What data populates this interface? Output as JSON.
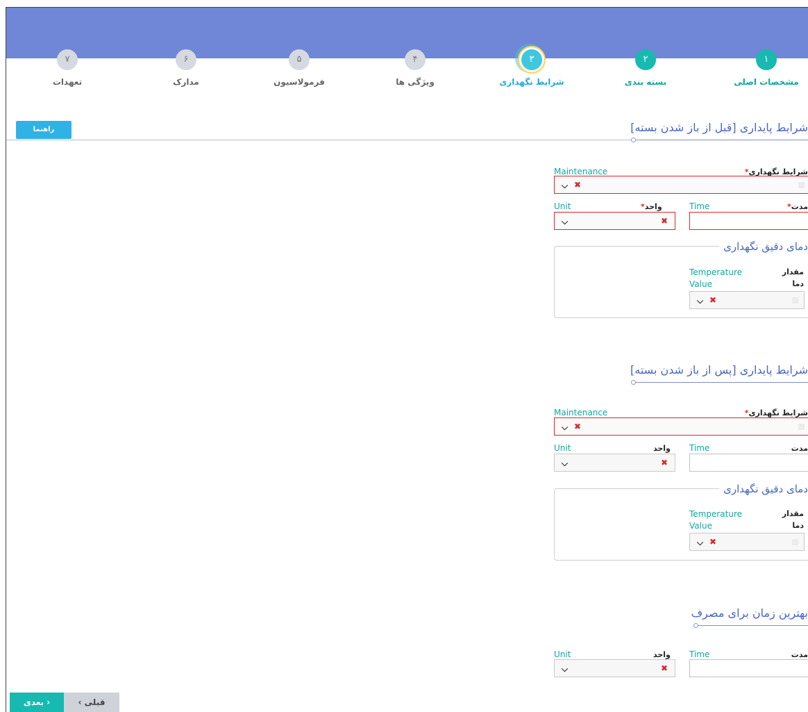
{
  "steps": [
    {
      "num": "۱",
      "label": "مشخصات اصلی",
      "state": "done"
    },
    {
      "num": "۲",
      "label": "بسته بندی",
      "state": "done"
    },
    {
      "num": "۳",
      "label": "شرایط نگهداری",
      "state": "active"
    },
    {
      "num": "۴",
      "label": "ویژگی ها",
      "state": "todo"
    },
    {
      "num": "۵",
      "label": "فرمولاسیون",
      "state": "todo"
    },
    {
      "num": "۶",
      "label": "مدارک",
      "state": "todo"
    },
    {
      "num": "۷",
      "label": "تعهدات",
      "state": "todo"
    }
  ],
  "help_button": "راهنما",
  "before_open": {
    "title": "شرایط پایداری [قبل از باز شدن بسته]",
    "maintenance_fa": "شرایط نگهداری",
    "maintenance_en": "Maintenance",
    "duration_fa": "مدت",
    "time_en": "Time",
    "unit_fa": "واحد",
    "unit_en": "Unit",
    "temp_panel_title": "دمای دقیق نگهداری",
    "temp_fa_1": "مقدار",
    "temp_fa_2": "دما",
    "temp_en_1": "Temperature",
    "temp_en_2": "Value"
  },
  "after_open": {
    "title": "شرایط پایداری [پس از باز شدن بسته]",
    "maintenance_fa": "شرایط نگهداری",
    "maintenance_en": "Maintenance",
    "duration_fa": "مدت",
    "time_en": "Time",
    "unit_fa": "واحد",
    "unit_en": "Unit",
    "temp_panel_title": "دمای دقیق نگهداری",
    "temp_fa_1": "مقدار",
    "temp_fa_2": "دما",
    "temp_en_1": "Temperature",
    "temp_en_2": "Value"
  },
  "best_time": {
    "title": "بهترین زمان برای مصرف",
    "duration_fa": "مدت",
    "time_en": "Time",
    "unit_fa": "واحد",
    "unit_en": "Unit"
  },
  "required_mark": "*",
  "nav": {
    "next": "بعدی ›",
    "prev": "‹ قبلی"
  },
  "colors": {
    "header": "#6f87d6",
    "teal": "#18b9b0",
    "accent_blue": "#2fb2e6",
    "error": "#e0242a"
  }
}
